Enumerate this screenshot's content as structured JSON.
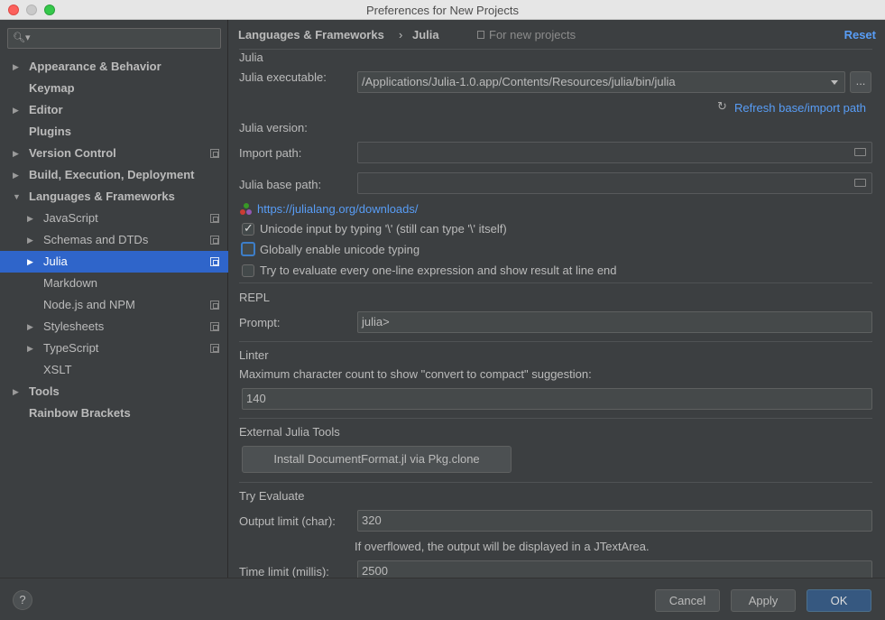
{
  "window": {
    "title": "Preferences for New Projects"
  },
  "sidebar": {
    "search_placeholder": "",
    "items": [
      {
        "label": "Appearance & Behavior",
        "bold": true,
        "arrow": true,
        "copy": false
      },
      {
        "label": "Keymap",
        "bold": true,
        "arrow": false,
        "copy": false
      },
      {
        "label": "Editor",
        "bold": true,
        "arrow": true,
        "copy": false
      },
      {
        "label": "Plugins",
        "bold": true,
        "arrow": false,
        "copy": false
      },
      {
        "label": "Version Control",
        "bold": true,
        "arrow": true,
        "copy": true
      },
      {
        "label": "Build, Execution, Deployment",
        "bold": true,
        "arrow": true,
        "copy": false
      },
      {
        "label": "Languages & Frameworks",
        "bold": true,
        "arrow": true,
        "expanded": true,
        "copy": false
      },
      {
        "label": "JavaScript",
        "arrow": true,
        "copy": true
      },
      {
        "label": "Schemas and DTDs",
        "arrow": true,
        "copy": true
      },
      {
        "label": "Julia",
        "arrow": true,
        "copy": true,
        "selected": true
      },
      {
        "label": "Markdown",
        "arrow": false,
        "copy": false
      },
      {
        "label": "Node.js and NPM",
        "arrow": false,
        "copy": true
      },
      {
        "label": "Stylesheets",
        "arrow": true,
        "copy": true
      },
      {
        "label": "TypeScript",
        "arrow": true,
        "copy": true
      },
      {
        "label": "XSLT",
        "arrow": false,
        "copy": false
      },
      {
        "label": "Tools",
        "bold": true,
        "arrow": true,
        "copy": false
      },
      {
        "label": "Rainbow Brackets",
        "bold": true,
        "arrow": false,
        "copy": false
      }
    ]
  },
  "header": {
    "breadcrumb_parent": "Languages & Frameworks",
    "breadcrumb_sep": "›",
    "breadcrumb_current": "Julia",
    "scope_label": "For new projects",
    "reset_label": "Reset"
  },
  "julia": {
    "section_title": "Julia",
    "executable_label": "Julia executable:",
    "executable_value": "/Applications/Julia-1.0.app/Contents/Resources/julia/bin/julia",
    "browse_label": "...",
    "refresh_label": "Refresh base/import path",
    "version_label": "Julia version:",
    "import_path_label": "Import path:",
    "import_path_value": "",
    "base_path_label": "Julia base path:",
    "base_path_value": "",
    "download_link": "https://julialang.org/downloads/",
    "unicode_input_label": "Unicode input by typing '\\' (still can type '\\' itself)",
    "unicode_input_checked": true,
    "global_unicode_label": "Globally enable unicode typing",
    "global_unicode_checked": false,
    "try_eval_label": "Try to evaluate every one-line expression and show result at line end",
    "try_eval_checked": false
  },
  "repl": {
    "section_title": "REPL",
    "prompt_label": "Prompt:",
    "prompt_value": "julia>"
  },
  "linter": {
    "section_title": "Linter",
    "max_chars_label": "Maximum character count to show \"convert to compact\" suggestion:",
    "max_chars_value": "140"
  },
  "external": {
    "section_title": "External Julia Tools",
    "install_button": "Install DocumentFormat.jl via Pkg.clone"
  },
  "try_evaluate": {
    "section_title": "Try Evaluate",
    "output_limit_label": "Output limit (char):",
    "output_limit_value": "320",
    "overflow_note": "If overflowed, the output will be displayed in a JTextArea.",
    "time_limit_label": "Time limit (millis):",
    "time_limit_value": "2500"
  },
  "footer": {
    "help_label": "?",
    "cancel_label": "Cancel",
    "apply_label": "Apply",
    "ok_label": "OK"
  },
  "colors": {
    "background": "#3c3f41",
    "selection": "#2f65ca",
    "link": "#589df6",
    "primary_button": "#365880"
  }
}
